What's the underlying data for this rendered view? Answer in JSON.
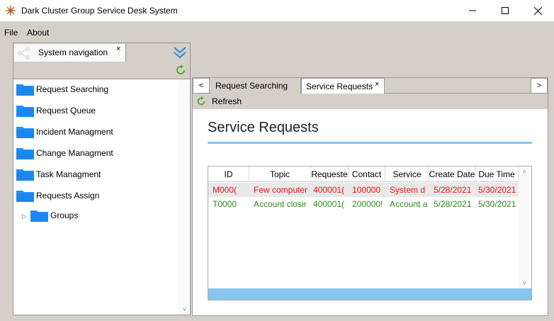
{
  "window": {
    "title": "Dark Cluster Group Service Desk System"
  },
  "menu": {
    "file": "File",
    "about": "About"
  },
  "nav": {
    "tab_label": "System navigation",
    "tab_close": "×",
    "items": [
      {
        "label": "Request Searching"
      },
      {
        "label": "Request Queue"
      },
      {
        "label": "Incident Managment"
      },
      {
        "label": "Change Managment"
      },
      {
        "label": "Task Managment"
      },
      {
        "label": "Requests Assign"
      },
      {
        "label": "Groups"
      }
    ]
  },
  "doc": {
    "prev": "<",
    "next": ">",
    "tabs": [
      {
        "label": "Request Searching"
      },
      {
        "label": "Service Requests",
        "close": "×"
      }
    ],
    "refresh_label": "Refresh",
    "page_title": "Service Requests"
  },
  "grid": {
    "columns": [
      "ID",
      "Topic",
      "Requeste",
      "Contact",
      "Service",
      "Create Date",
      "Due Time"
    ],
    "rows": [
      {
        "status": "red",
        "cells": [
          "M000(",
          "Few computer",
          "400001(",
          "100000",
          "System d",
          "5/28/2021",
          "5/30/2021"
        ]
      },
      {
        "status": "green",
        "cells": [
          "T0000",
          "Account closir",
          "400001(",
          "200000!",
          "Account a",
          "5/28/2021",
          "5/30/2021"
        ]
      }
    ]
  },
  "colors": {
    "accent": "#87c6ec",
    "folder": "#1e90ff",
    "row_red_text": "#e0191e",
    "row_green_text": "#2f8a1c"
  },
  "icons": [
    "app-icon",
    "minimize-icon",
    "maximize-icon",
    "close-icon",
    "share-icon",
    "chevron-double-down-icon",
    "refresh-icon",
    "folder-icon",
    "expand-arrow-icon"
  ]
}
